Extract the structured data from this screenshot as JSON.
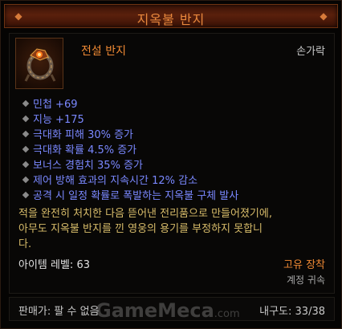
{
  "item": {
    "name": "지옥불 반지",
    "type": "전설 반지",
    "slot": "손가락",
    "affixes": [
      "민첩 +69",
      "지능 +175",
      "극대화 피해 30% 증가",
      "극대화 확률 4.5% 증가",
      "보너스 경험치 35% 증가",
      "제어 방해 효과의 지속시간 12% 감소",
      "공격 시 일정 확률로 폭발하는 지옥불 구체 발사"
    ],
    "flavor_lines": [
      "적을 완전히 처치한 다음 뜯어낸 전리품으로 만들어졌기에,",
      "아무도 지옥불 반지를 낀 영웅의 용기를 부정하지 못합니",
      "다."
    ],
    "item_level": "아이템 레벨: 63",
    "unique_equipped": "고유 장착",
    "account_bound": "계정 귀속",
    "sell_price": "판매가: 팔 수 없음",
    "durability": "내구도: 33/38",
    "icon": "ring-icon"
  },
  "watermark": {
    "text": "GameMeca",
    "suffix": ".com"
  },
  "colors": {
    "title": "#e9883d",
    "legendary": "#f08a34",
    "affix": "#7a88ff",
    "flavor": "#d8bc6a"
  }
}
